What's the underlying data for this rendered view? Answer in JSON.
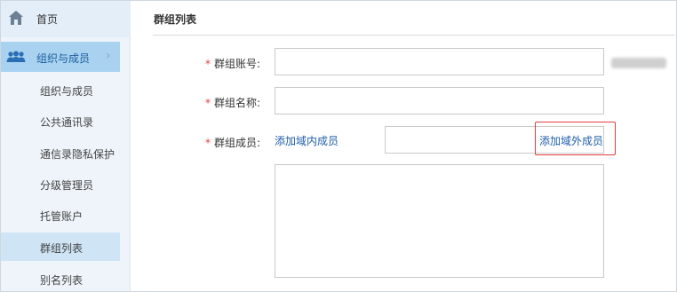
{
  "sidebar": {
    "home_label": "首页",
    "group_label": "组织与成员",
    "items": [
      {
        "label": "组织与成员"
      },
      {
        "label": "公共通讯录"
      },
      {
        "label": "通信录隐私保护"
      },
      {
        "label": "分级管理员"
      },
      {
        "label": "托管账户"
      },
      {
        "label": "群组列表"
      },
      {
        "label": "别名列表"
      }
    ],
    "active_item": "群组列表"
  },
  "main": {
    "title": "群组列表",
    "fields": {
      "account_label": "群组账号:",
      "name_label": "群组名称:",
      "members_label": "群组成员:"
    },
    "links": {
      "add_internal": "添加域内成员",
      "add_external": "添加域外成员"
    },
    "required_mark": "*"
  },
  "colors": {
    "accent": "#1f5fa8",
    "active_group_bg": "#a9d2f1",
    "required": "#e8413c",
    "highlight": "#e23c3c"
  },
  "icons": {
    "home": "home-icon",
    "group": "people-icon",
    "chevron": "chevron-right-icon"
  }
}
